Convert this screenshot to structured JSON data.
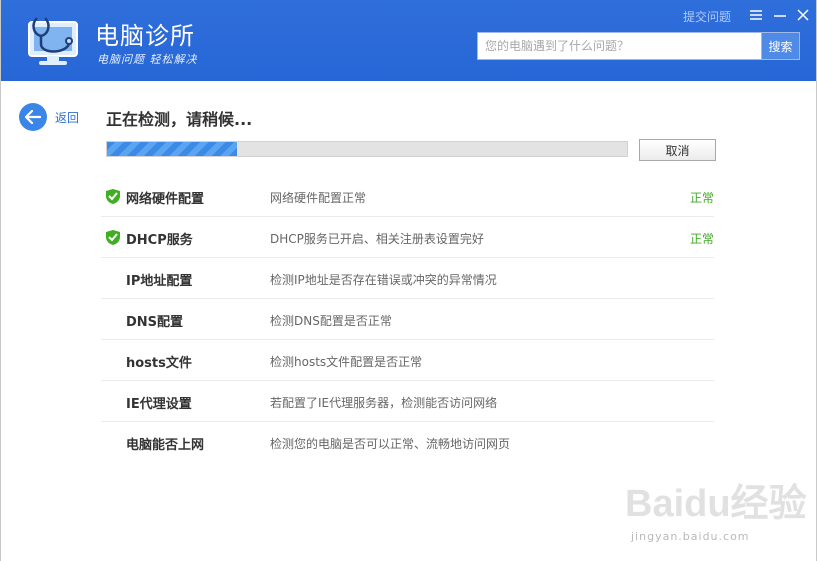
{
  "header": {
    "title": "电脑诊所",
    "subtitle": "电脑问题 轻松解决",
    "feedback_link": "提交问题",
    "search_placeholder": "您的电脑遇到了什么问题？",
    "search_button": "搜索"
  },
  "nav": {
    "back_label": "返回"
  },
  "main": {
    "status_title": "正在检测，请稍候...",
    "progress": 0.25,
    "cancel_label": "取消",
    "items": [
      {
        "name": "网络硬件配置",
        "desc": "网络硬件配置正常",
        "state": "正常",
        "checked": true
      },
      {
        "name": "DHCP服务",
        "desc": "DHCP服务已开启、相关注册表设置完好",
        "state": "正常",
        "checked": true
      },
      {
        "name": "IP地址配置",
        "desc": "检测IP地址是否存在错误或冲突的异常情况",
        "state": "",
        "checked": false
      },
      {
        "name": "DNS配置",
        "desc": "检测DNS配置是否正常",
        "state": "",
        "checked": false
      },
      {
        "name": "hosts文件",
        "desc": "检测hosts文件配置是否正常",
        "state": "",
        "checked": false
      },
      {
        "name": "IE代理设置",
        "desc": "若配置了IE代理服务器，检测能否访问网络",
        "state": "",
        "checked": false
      },
      {
        "name": "电脑能否上网",
        "desc": "检测您的电脑是否可以正常、流畅地访问网页",
        "state": "",
        "checked": false
      }
    ]
  },
  "watermark": {
    "brand": "Baidu经验",
    "url": "jingyan.baidu.com"
  },
  "colors": {
    "header": "#2766d6",
    "accent": "#3a86e8",
    "ok": "#3faa24"
  }
}
